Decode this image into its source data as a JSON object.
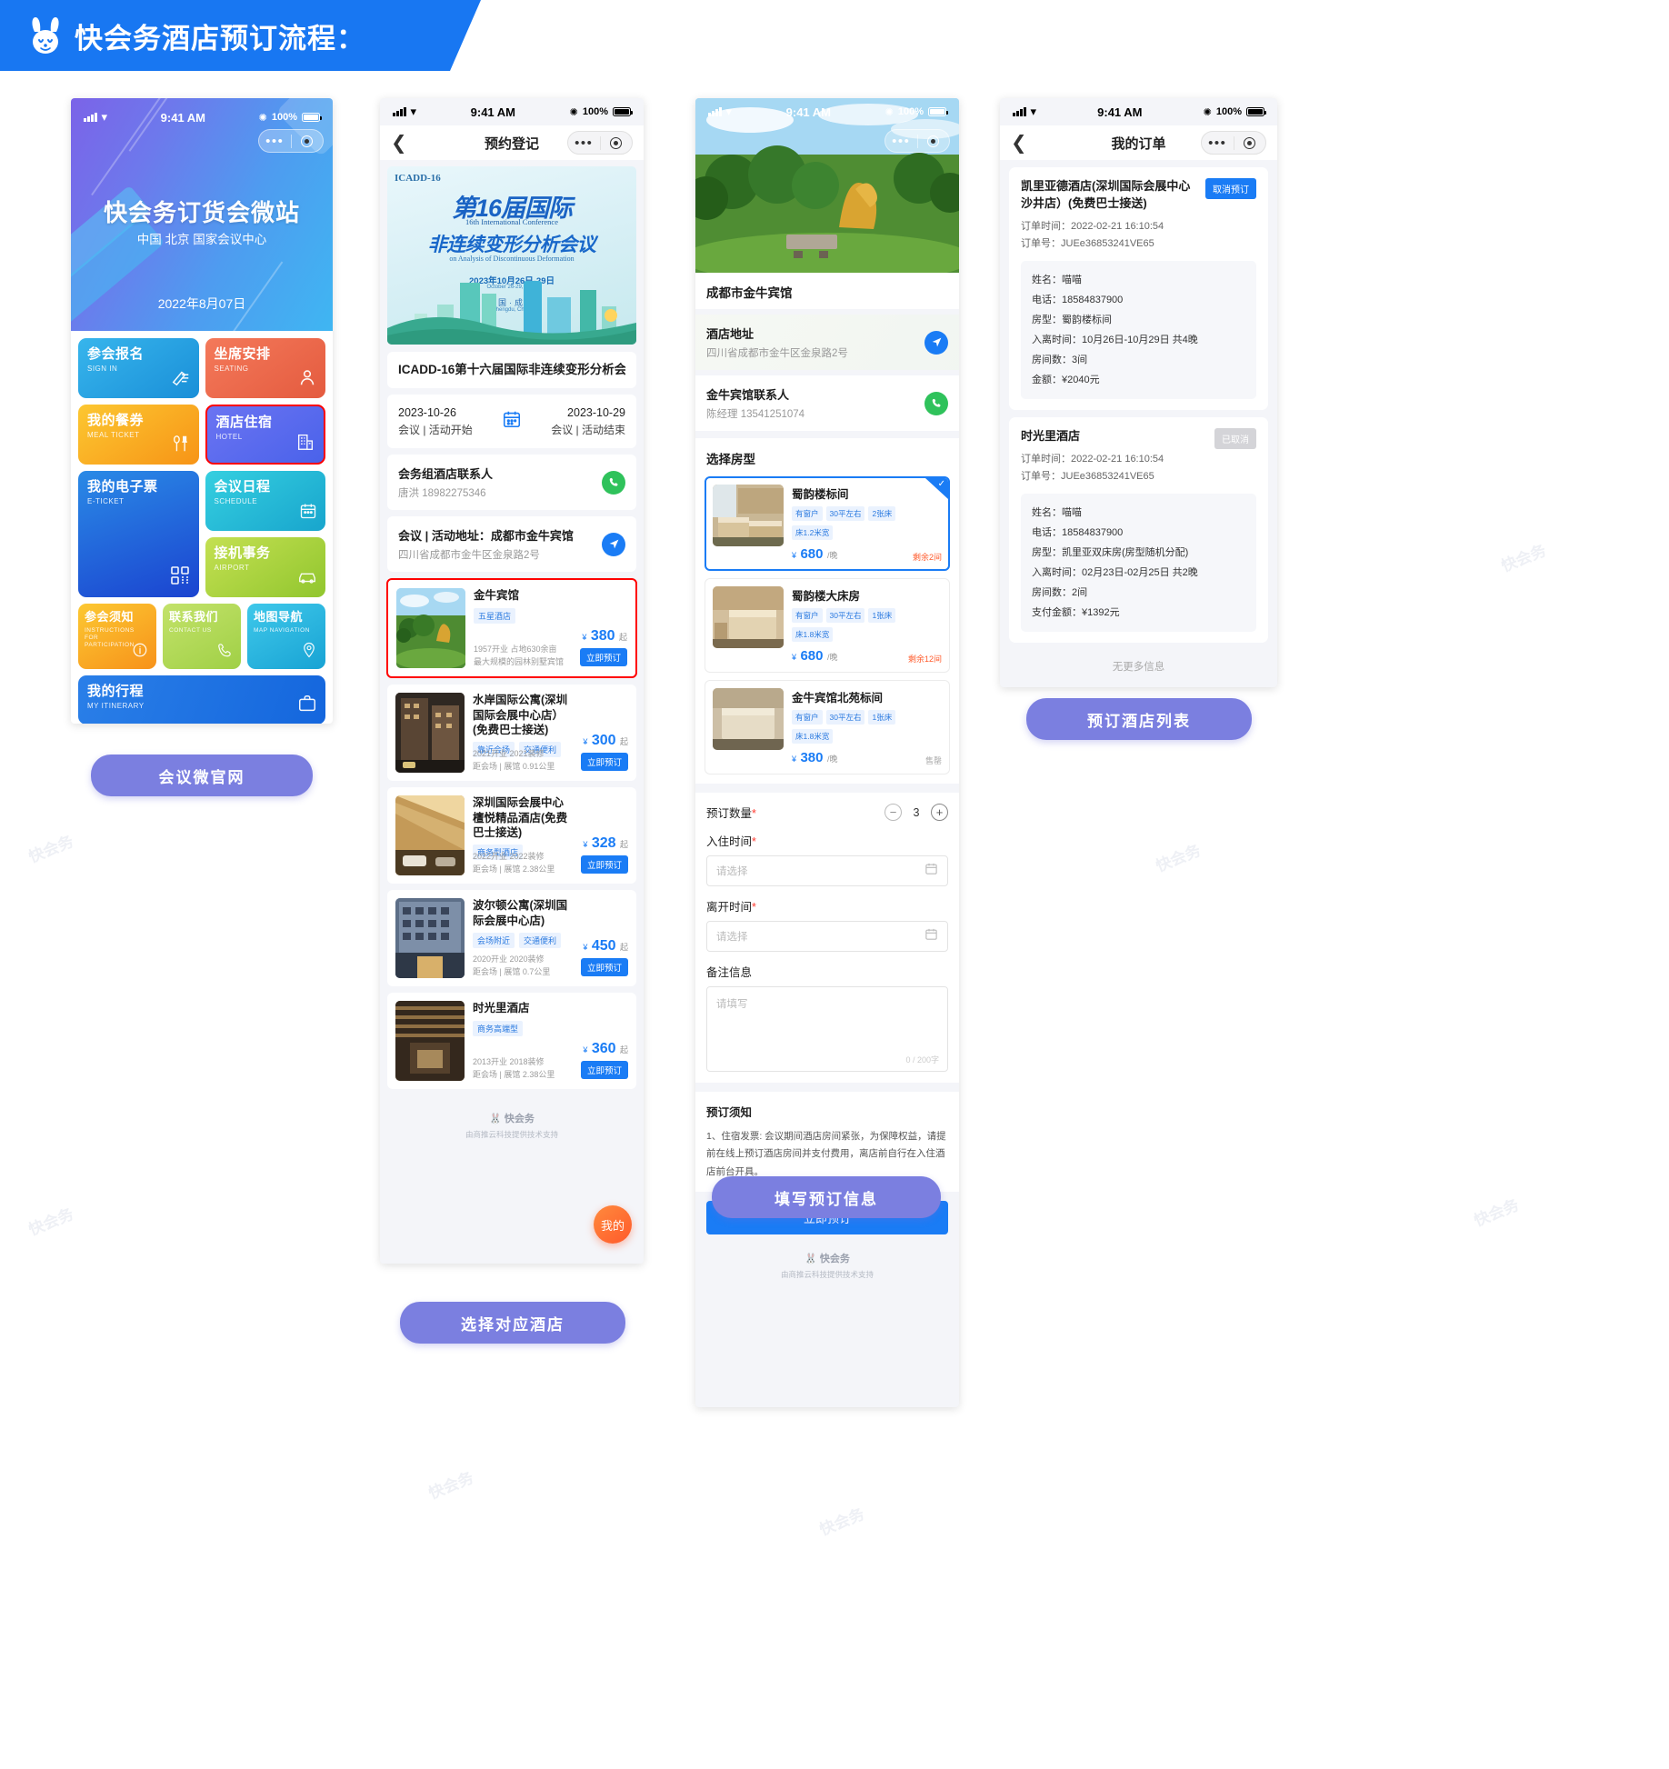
{
  "header": {
    "title": "快会务酒店预订流程：",
    "brand_color": "#1877f2",
    "bunny_icon": "bunny-logo"
  },
  "phone1": {
    "status": {
      "time": "9:41 AM",
      "battery": "100%"
    },
    "hero": {
      "title": "快会务订货会微站",
      "subtitle": "中国 北京 国家会议中心",
      "date": "2022年8月07日"
    },
    "tiles": [
      {
        "cn": "参会报名",
        "en": "SIGN IN",
        "icon": "pencil-icon",
        "color": "#2aa8e8"
      },
      {
        "cn": "坐席安排",
        "en": "SEATING",
        "icon": "person-icon",
        "color": "#ee6a4c"
      },
      {
        "cn": "我的餐券",
        "en": "MEAL TICKET",
        "icon": "cutlery-icon",
        "color": "#f7a91b"
      },
      {
        "cn": "酒店住宿",
        "en": "HOTEL",
        "icon": "building-icon",
        "color": "#5b6ef0",
        "highlighted": true
      },
      {
        "cn": "我的电子票",
        "en": "E-TICKET",
        "icon": "qrcode-icon",
        "color": "#1c5fd6"
      },
      {
        "cn": "会议日程",
        "en": "SCHEDULE",
        "icon": "calendar-icon",
        "color": "#20b9d8"
      },
      {
        "cn": "接机事务",
        "en": "AIRPORT",
        "icon": "car-icon",
        "color": "#a6d33a"
      },
      {
        "cn": "参会须知",
        "en": "INSTRUCTIONS FOR PARTICIPATION",
        "icon": "info-icon",
        "color": "#f9a81a"
      },
      {
        "cn": "联系我们",
        "en": "CONTACT US",
        "icon": "phone-icon",
        "color": "#a7d657"
      },
      {
        "cn": "地图导航",
        "en": "MAP NAVIGATION",
        "icon": "pin-icon",
        "color": "#22b5e6"
      },
      {
        "cn": "我的行程",
        "en": "MY ITINERARY",
        "icon": "briefcase-icon",
        "color": "#1b74e4"
      }
    ],
    "caption": "会议微官网"
  },
  "phone2": {
    "status": {
      "time": "9:41 AM",
      "battery": "100%"
    },
    "nav_title": "预约登记",
    "poster": {
      "code": "ICADD-16",
      "edition": "第16届国际",
      "edition_en": "16th International Conference",
      "topic": "非连续变形分析会议",
      "topic_en": "on Analysis of Discontinuous Deformation",
      "date_cn": "2023年10月26日-29日",
      "date_en": "October 26-29, 2023",
      "city_cn": "中国·成都",
      "city_en": "Chengdu, China"
    },
    "conference_title": "ICADD-16第十六届国际非连续变形分析会议",
    "dates": {
      "start_date": "2023-10-26",
      "start_label": "会议 | 活动开始",
      "end_date": "2023-10-29",
      "end_label": "会议 | 活动结束",
      "icon": "calendar-icon"
    },
    "contact": {
      "title": "会务组酒店联系人",
      "sub": "唐洪 18982275346",
      "icon": "phone-icon"
    },
    "address": {
      "title": "会议 | 活动地址：成都市金牛宾馆",
      "sub": "四川省成都市金牛区金泉路2号",
      "icon": "navigation-icon"
    },
    "hotels": [
      {
        "name": "金牛宾馆",
        "tags": [
          "五星酒店"
        ],
        "meta1": "1957开业  占地630余亩",
        "meta2": "最大规模的园林别墅宾馆",
        "price": "380",
        "unit": "起",
        "btn": "立即预订",
        "selected": true,
        "img": "garden-photo"
      },
      {
        "name": "水岸国际公寓(深圳国际会展中心店）(免费巴士接送)",
        "tags": [
          "靠近会场",
          "交通便利"
        ],
        "meta1": "2021开业  2021装修",
        "meta2": "距会场 | 展馆 0.91公里",
        "price": "300",
        "unit": "起",
        "btn": "立即预订",
        "img": "building-photo"
      },
      {
        "name": "深圳国际会展中心檀悦精品酒店(免费巴士接送)",
        "tags": [
          "商务型酒店"
        ],
        "meta1": "2022开业  2022装修",
        "meta2": "距会场 | 展馆 2.38公里",
        "price": "328",
        "unit": "起",
        "btn": "立即预订",
        "img": "lobby-photo"
      },
      {
        "name": "波尔顿公寓(深圳国际会展中心店)",
        "tags": [
          "会场附近",
          "交通便利"
        ],
        "meta1": "2020开业  2020装修",
        "meta2": "距会场 | 展馆 0.7公里",
        "price": "450",
        "unit": "起",
        "btn": "立即预订",
        "img": "exterior-photo"
      },
      {
        "name": "时光里酒店",
        "tags": [
          "商务高端型"
        ],
        "meta1": "2013开业  2018装修",
        "meta2": "距会场 | 展馆 2.38公里",
        "price": "360",
        "unit": "起",
        "btn": "立即预订",
        "img": "interior-photo"
      }
    ],
    "footer": {
      "brand": "快会务",
      "sub": "由商推云科技提供技术支持"
    },
    "fab": "我的",
    "caption": "选择对应酒店"
  },
  "phone3": {
    "status": {
      "time": "9:41 AM",
      "battery": "100%"
    },
    "hotel_name": "成都市金牛宾馆",
    "address_block": {
      "title": "酒店地址",
      "sub": "四川省成都市金牛区金泉路2号",
      "icon": "navigation-icon"
    },
    "contact_block": {
      "title": "金牛宾馆联系人",
      "sub": "陈经理 13541251074",
      "icon": "phone-icon"
    },
    "room_section_title": "选择房型",
    "rooms": [
      {
        "name": "蜀韵楼标间",
        "tags": [
          "有窗户",
          "30平左右",
          "2张床",
          "床1.2米宽"
        ],
        "price": "680",
        "unit": "/晚",
        "stock": "剩余2间",
        "selected": true,
        "img": "twin-room-photo"
      },
      {
        "name": "蜀韵楼大床房",
        "tags": [
          "有窗户",
          "30平左右",
          "1张床",
          "床1.8米宽"
        ],
        "price": "680",
        "unit": "/晚",
        "stock": "剩余12间",
        "selected": false,
        "img": "king-room-photo"
      },
      {
        "name": "金牛宾馆北苑标间",
        "tags": [
          "有窗户",
          "30平左右",
          "1张床",
          "床1.8米宽"
        ],
        "price": "380",
        "unit": "/晚",
        "stock": "售罄",
        "sold_out": true,
        "selected": false,
        "img": "north-room-photo"
      }
    ],
    "form": {
      "qty_label": "预订数量",
      "qty_value": "3",
      "checkin_label": "入住时间",
      "checkin_placeholder": "请选择",
      "checkout_label": "离开时间",
      "checkout_placeholder": "请选择",
      "remark_label": "备注信息",
      "remark_placeholder": "请填写",
      "remark_counter": "0 / 200字",
      "calendar_icon": "calendar-icon"
    },
    "notice": {
      "title": "预订须知",
      "body": "1、住宿发票: 会议期间酒店房间紧张，为保障权益，请提前在线上预订酒店房间并支付费用，离店前自行在入住酒店前台开具。"
    },
    "submit": "立即预订",
    "footer": {
      "brand": "快会务",
      "sub": "由商推云科技提供技术支持"
    },
    "caption": "填写预订信息"
  },
  "phone4": {
    "status": {
      "time": "9:41 AM",
      "battery": "100%"
    },
    "nav_title": "我的订单",
    "orders": [
      {
        "title": "凯里亚德酒店(深圳国际会展中心沙井店）(免费巴士接送)",
        "action": "取消预订",
        "action_state": "active",
        "order_time": "订单时间：2022-02-21 16:10:54",
        "order_no": "订单号：JUEe36853241VE65",
        "details": [
          "姓名：喵喵",
          "电话：18584837900",
          "房型：蜀韵楼标间",
          "入离时间：10月26日-10月29日  共4晚",
          "房间数：3间",
          "金额：¥2040元"
        ]
      },
      {
        "title": "时光里酒店",
        "action": "已取消",
        "action_state": "disabled",
        "order_time": "订单时间：2022-02-21 16:10:54",
        "order_no": "订单号：JUEe36853241VE65",
        "details": [
          "姓名：喵喵",
          "电话：18584837900",
          "房型：凯里亚双床房(房型随机分配)",
          "入离时间：02月23日-02月25日  共2晚",
          "房间数：2间",
          "支付金额：¥1392元"
        ]
      }
    ],
    "no_more": "无更多信息",
    "caption": "预订酒店列表"
  },
  "watermark": "快会务"
}
